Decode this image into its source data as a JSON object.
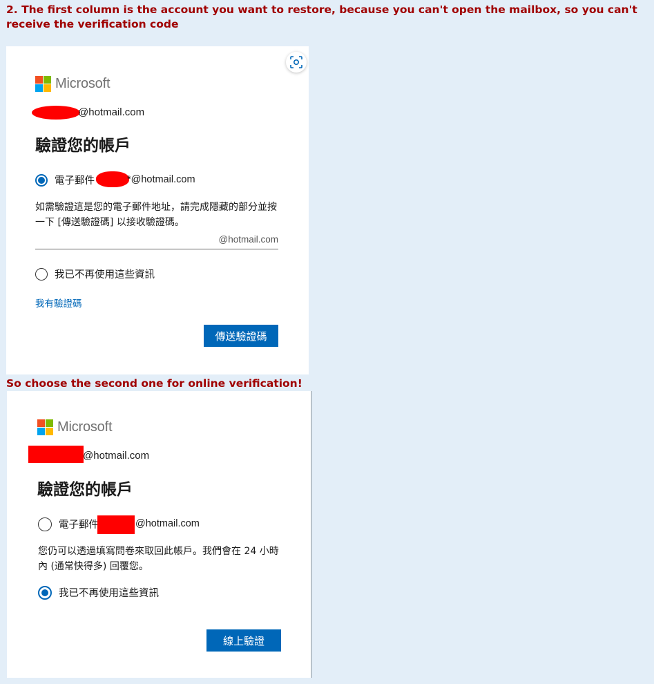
{
  "instructions": {
    "heading1": "2. The first column is the account you want to restore, because you can't open the mailbox, so you can't receive the verification code",
    "heading2": "So choose the second one for online verification!"
  },
  "colors": {
    "microsoft_blue": "#0067b8",
    "heading_red": "#a00000",
    "redaction": "#ff0000",
    "logo": [
      "#f25022",
      "#7fba00",
      "#00a4ef",
      "#ffb900"
    ]
  },
  "card1": {
    "brand": "Microsoft",
    "account_suffix": "@hotmail.com",
    "title": "驗證您的帳戶",
    "option_email_prefix": "電子郵件",
    "option_email_suffix": "*@hotmail.com",
    "instruction": "如需驗證這是您的電子郵件地址，請完成隱藏的部分並按一下 [傳送驗證碼] 以接收驗證碼。",
    "input_suffix": "@hotmail.com",
    "option_no_access": "我已不再使用這些資訊",
    "have_code_link": "我有驗證碼",
    "send_code_button": "傳送驗證碼",
    "selected_option": "email",
    "scan_icon": "visual-search-icon"
  },
  "card2": {
    "brand": "Microsoft",
    "account_suffix": "@hotmail.com",
    "title": "驗證您的帳戶",
    "option_email_prefix": "電子郵件",
    "option_email_suffix": "@hotmail.com",
    "instruction": "您仍可以透過填寫問卷來取回此帳戶。我們會在 24 小時內 (通常快得多) 回覆您。",
    "option_no_access": "我已不再使用這些資訊",
    "online_verify_button": "線上驗證",
    "selected_option": "no_access"
  }
}
